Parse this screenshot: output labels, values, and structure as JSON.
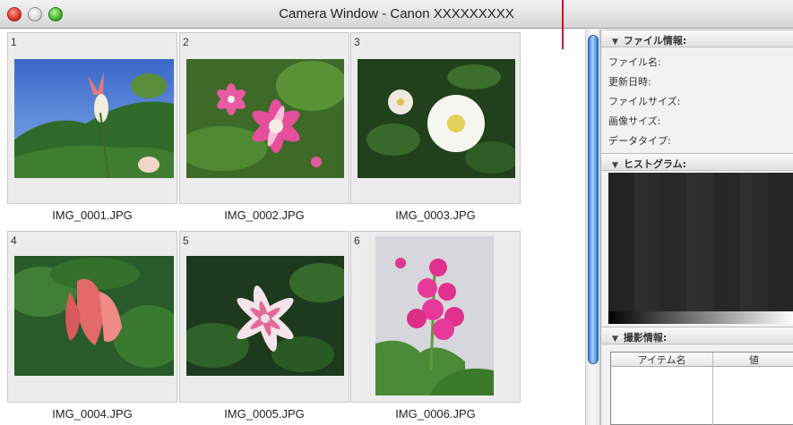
{
  "window": {
    "title": "Camera Window - Canon XXXXXXXXX"
  },
  "thumbnails": [
    {
      "index": "1",
      "filename": "IMG_0001.JPG"
    },
    {
      "index": "2",
      "filename": "IMG_0002.JPG"
    },
    {
      "index": "3",
      "filename": "IMG_0003.JPG"
    },
    {
      "index": "4",
      "filename": "IMG_0004.JPG"
    },
    {
      "index": "5",
      "filename": "IMG_0005.JPG"
    },
    {
      "index": "6",
      "filename": "IMG_0006.JPG"
    }
  ],
  "panel": {
    "file_info": {
      "header": "ファイル情報:",
      "rows": [
        "ファイル名:",
        "更新日時:",
        "ファイルサイズ:",
        "画像サイズ:",
        "データタイプ:"
      ]
    },
    "histogram": {
      "header": "ヒストグラム:"
    },
    "shooting_info": {
      "header": "撮影情報:",
      "columns": [
        "アイテム名",
        "値"
      ]
    }
  },
  "icons": {
    "close": "close-window-icon",
    "minimize": "minimize-window-icon",
    "zoom": "zoom-window-icon",
    "disclosure": "disclosure-triangle-icon"
  },
  "colors": {
    "scroll_thumb": "#5e9ae8",
    "close": "#e0332a",
    "zoom": "#3fb52a"
  }
}
